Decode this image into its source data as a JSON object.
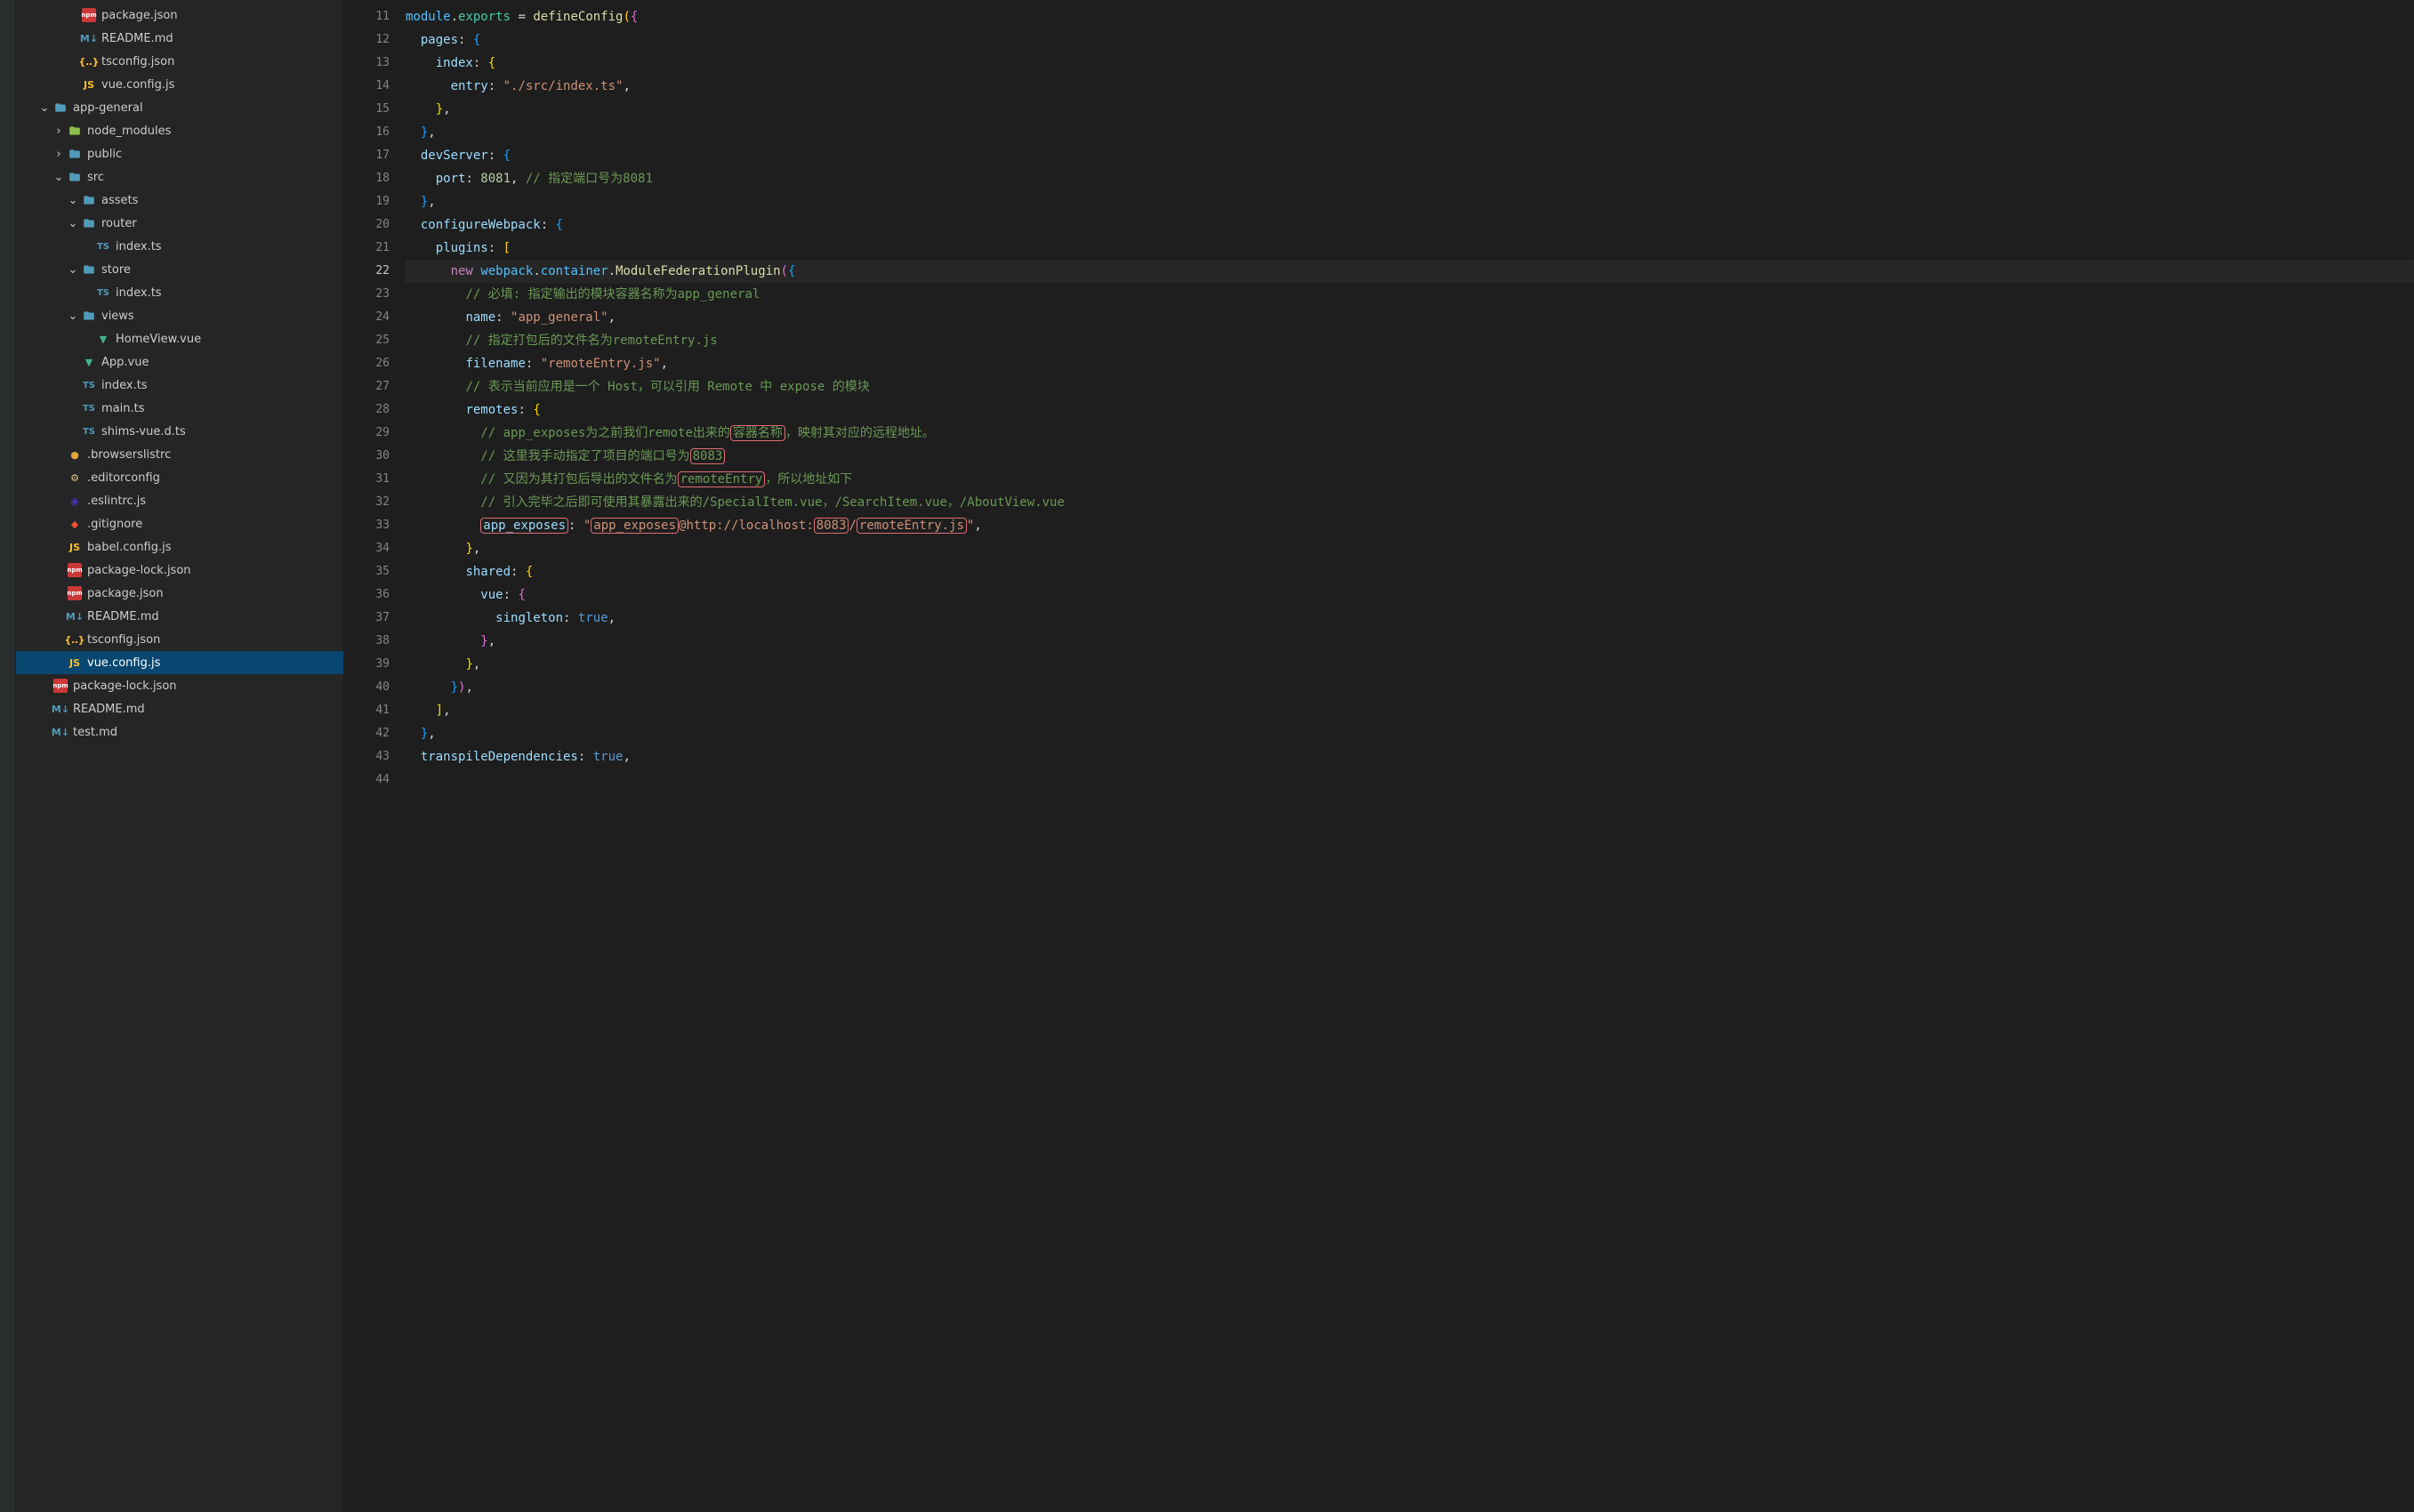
{
  "sidebar": {
    "items": [
      {
        "indent": 3,
        "icon": "npm",
        "label": "package.json",
        "chev": ""
      },
      {
        "indent": 3,
        "icon": "md",
        "label": "README.md",
        "chev": ""
      },
      {
        "indent": 3,
        "icon": "json",
        "label": "tsconfig.json",
        "chev": ""
      },
      {
        "indent": 3,
        "icon": "js",
        "label": "vue.config.js",
        "chev": ""
      },
      {
        "indent": 1,
        "icon": "folder",
        "label": "app-general",
        "chev": "down"
      },
      {
        "indent": 2,
        "icon": "folder-green",
        "label": "node_modules",
        "chev": "right"
      },
      {
        "indent": 2,
        "icon": "folder",
        "label": "public",
        "chev": "right"
      },
      {
        "indent": 2,
        "icon": "folder",
        "label": "src",
        "chev": "down"
      },
      {
        "indent": 3,
        "icon": "folder",
        "label": "assets",
        "chev": "down"
      },
      {
        "indent": 3,
        "icon": "folder",
        "label": "router",
        "chev": "down"
      },
      {
        "indent": 4,
        "icon": "ts",
        "label": "index.ts",
        "chev": ""
      },
      {
        "indent": 3,
        "icon": "folder",
        "label": "store",
        "chev": "down"
      },
      {
        "indent": 4,
        "icon": "ts",
        "label": "index.ts",
        "chev": ""
      },
      {
        "indent": 3,
        "icon": "folder",
        "label": "views",
        "chev": "down"
      },
      {
        "indent": 4,
        "icon": "vue",
        "label": "HomeView.vue",
        "chev": ""
      },
      {
        "indent": 3,
        "icon": "vue",
        "label": "App.vue",
        "chev": ""
      },
      {
        "indent": 3,
        "icon": "ts",
        "label": "index.ts",
        "chev": ""
      },
      {
        "indent": 3,
        "icon": "ts",
        "label": "main.ts",
        "chev": ""
      },
      {
        "indent": 3,
        "icon": "ts",
        "label": "shims-vue.d.ts",
        "chev": ""
      },
      {
        "indent": 2,
        "icon": "browserslist",
        "label": ".browserslistrc",
        "chev": ""
      },
      {
        "indent": 2,
        "icon": "config",
        "label": ".editorconfig",
        "chev": ""
      },
      {
        "indent": 2,
        "icon": "eslint",
        "label": ".eslintrc.js",
        "chev": ""
      },
      {
        "indent": 2,
        "icon": "git",
        "label": ".gitignore",
        "chev": ""
      },
      {
        "indent": 2,
        "icon": "js",
        "label": "babel.config.js",
        "chev": ""
      },
      {
        "indent": 2,
        "icon": "npm",
        "label": "package-lock.json",
        "chev": ""
      },
      {
        "indent": 2,
        "icon": "npm",
        "label": "package.json",
        "chev": ""
      },
      {
        "indent": 2,
        "icon": "md",
        "label": "README.md",
        "chev": ""
      },
      {
        "indent": 2,
        "icon": "json",
        "label": "tsconfig.json",
        "chev": ""
      },
      {
        "indent": 2,
        "icon": "js",
        "label": "vue.config.js",
        "chev": "",
        "selected": true
      },
      {
        "indent": 1,
        "icon": "npm",
        "label": "package-lock.json",
        "chev": ""
      },
      {
        "indent": 1,
        "icon": "md",
        "label": "README.md",
        "chev": ""
      },
      {
        "indent": 1,
        "icon": "md",
        "label": "test.md",
        "chev": ""
      }
    ]
  },
  "editor": {
    "lineStart": 11,
    "activeLine": 22,
    "lines": {
      "l11": {
        "a": "module",
        "b": ".",
        "c": "exports",
        "d": " = ",
        "e": "defineConfig",
        "f": "(",
        "g": "{"
      },
      "l12": {
        "a": "pages",
        "b": ": ",
        "c": "{"
      },
      "l13": {
        "a": "index",
        "b": ": ",
        "c": "{"
      },
      "l14": {
        "a": "entry",
        "b": ": ",
        "c": "\"./src/index.ts\"",
        "d": ","
      },
      "l15": {
        "a": "}",
        "b": ","
      },
      "l16": {
        "a": "}",
        "b": ","
      },
      "l17": {
        "a": "devServer",
        "b": ": ",
        "c": "{"
      },
      "l18": {
        "a": "port",
        "b": ": ",
        "c": "8081",
        "d": ", ",
        "e": "// 指定端口号为8081"
      },
      "l19": {
        "a": "}",
        "b": ","
      },
      "l20": {
        "a": "configureWebpack",
        "b": ": ",
        "c": "{"
      },
      "l21": {
        "a": "plugins",
        "b": ": ",
        "c": "["
      },
      "l22": {
        "a": "new",
        "b": " ",
        "c": "webpack",
        "d": ".",
        "e": "container",
        "f": ".",
        "g": "ModuleFederationPlugin",
        "h": "(",
        "i": "{"
      },
      "l23": {
        "a": "// 必填: 指定输出的模块容器名称为app_general"
      },
      "l24": {
        "a": "name",
        "b": ": ",
        "c": "\"app_general\"",
        "d": ","
      },
      "l25": {
        "a": "// 指定打包后的文件名为remoteEntry.js"
      },
      "l26": {
        "a": "filename",
        "b": ": ",
        "c": "\"remoteEntry.js\"",
        "d": ","
      },
      "l27": {
        "a": "// 表示当前应用是一个 Host，可以引用 Remote 中 expose 的模块"
      },
      "l28": {
        "a": "remotes",
        "b": ": ",
        "c": "{"
      },
      "l29": {
        "a": "// app_exposes为之前我们remote出来的",
        "b": "容器名称",
        "c": "，映射其对应的远程地址。"
      },
      "l30": {
        "a": "// 这里我手动指定了项目的端口号为",
        "b": "8083"
      },
      "l31": {
        "a": "// 又因为其打包后导出的文件名为",
        "b": "remoteEntry",
        "c": "，所以地址如下"
      },
      "l32": {
        "a": "// 引入完毕之后即可使用其暴露出来的/SpecialItem.vue，/SearchItem.vue，/AboutView.vue"
      },
      "l33": {
        "a": "app_exposes",
        "b": ": ",
        "c": "\"",
        "d": "app_exposes",
        "e": "@http://localhost:",
        "f": "8083",
        "g": "/",
        "h": "remoteEntry.js",
        "i": "\"",
        "j": ","
      },
      "l34": {
        "a": "}",
        "b": ","
      },
      "l35": {
        "a": "shared",
        "b": ": ",
        "c": "{"
      },
      "l36": {
        "a": "vue",
        "b": ": ",
        "c": "{"
      },
      "l37": {
        "a": "singleton",
        "b": ": ",
        "c": "true",
        "d": ","
      },
      "l38": {
        "a": "}",
        "b": ","
      },
      "l39": {
        "a": "}",
        "b": ","
      },
      "l40": {
        "a": "}",
        "b": ")",
        "c": ","
      },
      "l41": {
        "a": "]",
        "b": ","
      },
      "l42": {
        "a": "}",
        "b": ","
      },
      "l43": {
        "a": "transpileDependencies",
        "b": ": ",
        "c": "true",
        "d": ","
      }
    }
  }
}
